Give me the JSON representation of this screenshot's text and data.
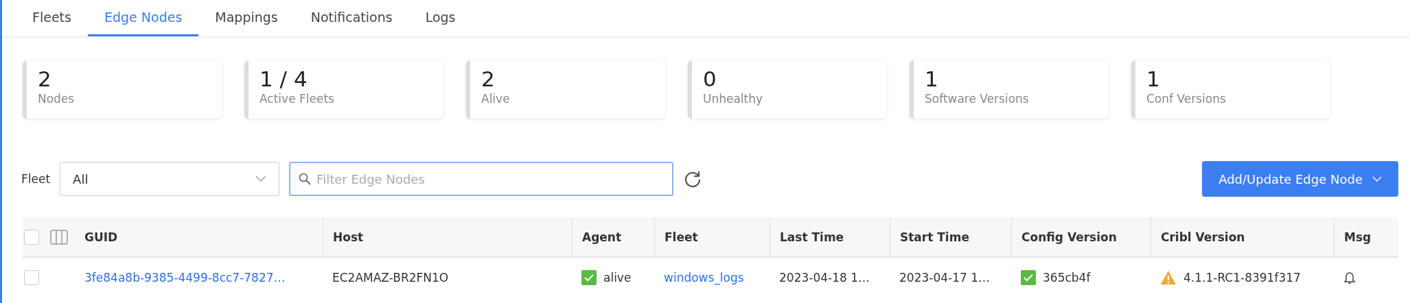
{
  "tabs": [
    {
      "label": "Fleets",
      "selected": false
    },
    {
      "label": "Edge Nodes",
      "selected": true
    },
    {
      "label": "Mappings",
      "selected": false
    },
    {
      "label": "Notifications",
      "selected": false
    },
    {
      "label": "Logs",
      "selected": false
    }
  ],
  "stats": [
    {
      "value": "2",
      "label": "Nodes"
    },
    {
      "value": "1 / 4",
      "label": "Active Fleets"
    },
    {
      "value": "2",
      "label": "Alive"
    },
    {
      "value": "0",
      "label": "Unhealthy"
    },
    {
      "value": "1",
      "label": "Software Versions"
    },
    {
      "value": "1",
      "label": "Conf Versions"
    }
  ],
  "filter": {
    "fleet_label": "Fleet",
    "fleet_value": "All",
    "search_placeholder": "Filter Edge Nodes",
    "add_button": "Add/Update Edge Node"
  },
  "table": {
    "select_all_checked": false,
    "columns": [
      "GUID",
      "Host",
      "Agent",
      "Fleet",
      "Last Time",
      "Start Time",
      "Config Version",
      "Cribl Version",
      "Msg"
    ],
    "rows": [
      {
        "checked": false,
        "guid": "3fe84a8b-9385-4499-8cc7-7827…",
        "host": "EC2AMAZ-BR2FN1O",
        "agent": {
          "text": "alive",
          "ok": true
        },
        "fleet": "windows_logs",
        "last_time": "2023-04-18 1…",
        "start_time": "2023-04-17 1…",
        "config_version": {
          "text": "365cb4f",
          "ok": true
        },
        "cribl_version": {
          "text": "4.1.1-RC1-8391f317",
          "warning": true
        }
      }
    ]
  }
}
